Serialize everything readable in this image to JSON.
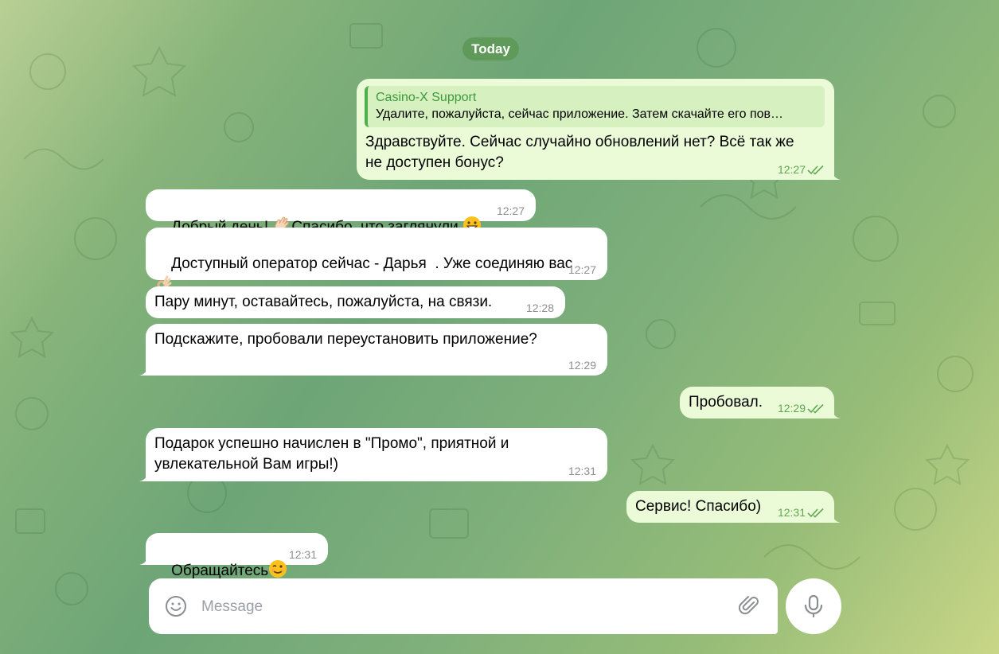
{
  "date_divider": "Today",
  "messages": [
    {
      "id": "m0",
      "direction": "out",
      "reply": {
        "author": "Casino-X Support",
        "text": "Удалите, пожалуйста, сейчас приложение. Затем скачайте его пов…"
      },
      "text": "Здравствуйте. Сейчас случайно обновлений нет? Всё так же\nне доступен бонус?",
      "time": "12:27"
    },
    {
      "id": "m1",
      "direction": "in",
      "text": "Добрый день! ",
      "text2": "Спасибо, что заглянули ",
      "time": "12:27"
    },
    {
      "id": "m2",
      "direction": "in",
      "text": "Доступный оператор сейчас - Дарья  . Уже соединяю вас",
      "time": "12:27"
    },
    {
      "id": "m3",
      "direction": "in",
      "text": "Пару минут, оставайтесь, пожалуйста, на связи.",
      "time": "12:28"
    },
    {
      "id": "m4",
      "direction": "in",
      "text": "Подскажите, пробовали переустановить приложение?",
      "time": "12:29"
    },
    {
      "id": "m5",
      "direction": "out",
      "text": "Пробовал.",
      "time": "12:29"
    },
    {
      "id": "m6",
      "direction": "in",
      "text": "Подарок успешно начислен в \"Промо\", приятной и\nувлекательной Вам игры!)",
      "time": "12:31"
    },
    {
      "id": "m7",
      "direction": "out",
      "text": "Сервис! Спасибо)",
      "time": "12:31"
    },
    {
      "id": "m8",
      "direction": "in",
      "text": "Обращайтесь",
      "time": "12:31"
    }
  ],
  "composer": {
    "placeholder": "Message",
    "value": ""
  },
  "icons": {
    "emoji": "emoji-smile-icon",
    "attach": "paperclip-icon",
    "mic": "microphone-icon",
    "read": "double-check-icon"
  },
  "colors": {
    "incoming_bubble": "#ffffff",
    "outgoing_bubble": "#ebfbd7",
    "outgoing_time": "#5ea84f",
    "accent": "#4fae4e"
  }
}
